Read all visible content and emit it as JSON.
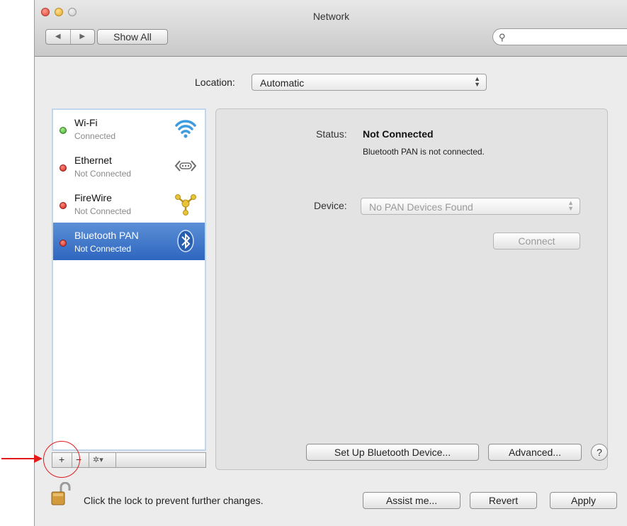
{
  "window": {
    "title": "Network"
  },
  "toolbar": {
    "back": "◀",
    "forward": "▶",
    "show_all": "Show All",
    "search_placeholder": ""
  },
  "location": {
    "label": "Location:",
    "value": "Automatic"
  },
  "services": [
    {
      "name": "Wi-Fi",
      "status": "Connected",
      "dot": "green",
      "icon": "wifi-icon"
    },
    {
      "name": "Ethernet",
      "status": "Not Connected",
      "dot": "red",
      "icon": "ethernet-icon"
    },
    {
      "name": "FireWire",
      "status": "Not Connected",
      "dot": "red",
      "icon": "firewire-icon"
    },
    {
      "name": "Bluetooth PAN",
      "status": "Not Connected",
      "dot": "red",
      "icon": "bluetooth-icon",
      "selected": true
    }
  ],
  "sidebar_controls": {
    "add": "+",
    "remove": "−",
    "action": "✲▾"
  },
  "detail": {
    "status_label": "Status:",
    "status_value": "Not Connected",
    "status_desc": "Bluetooth PAN is not connected.",
    "device_label": "Device:",
    "device_value": "No PAN Devices Found",
    "connect": "Connect",
    "setup_bt": "Set Up Bluetooth Device...",
    "advanced": "Advanced...",
    "help": "?"
  },
  "footer": {
    "lock_text": "Click the lock to prevent further changes.",
    "assist": "Assist me...",
    "revert": "Revert",
    "apply": "Apply"
  },
  "colors": {
    "selection": "#3b72c8",
    "green": "#3aa52a",
    "red": "#c9221a",
    "annotation": "#e21b1b"
  }
}
